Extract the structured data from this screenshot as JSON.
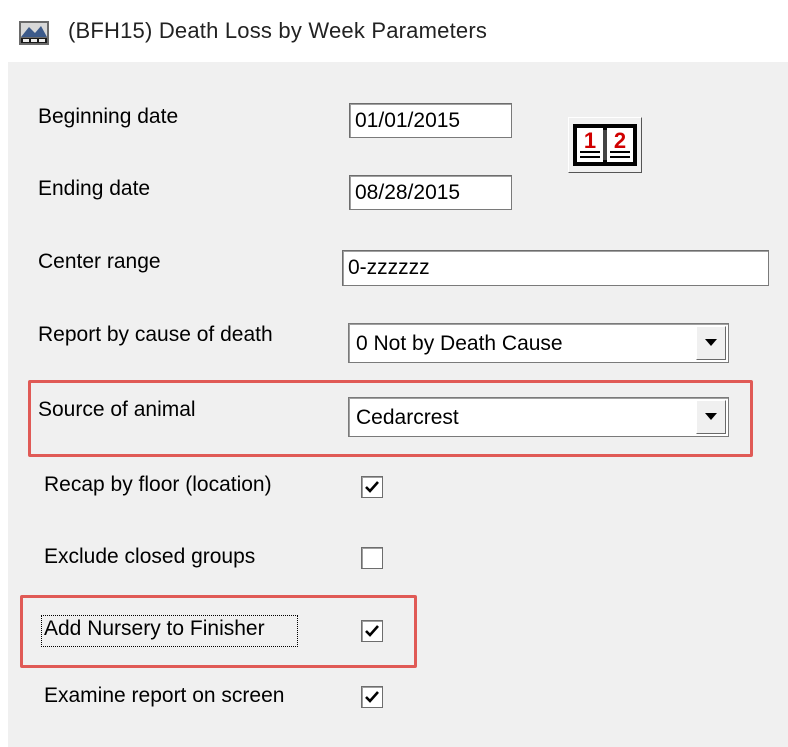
{
  "window": {
    "title": "(BFH15)  Death Loss by Week Parameters"
  },
  "fields": {
    "beginning_date": {
      "label": "Beginning date",
      "value": "01/01/2015"
    },
    "ending_date": {
      "label": "Ending date",
      "value": "08/28/2015"
    },
    "center_range": {
      "label": "Center range",
      "value": "0-zzzzzz"
    },
    "cause_of_death": {
      "label": "Report by cause of death",
      "value": "0  Not by Death Cause"
    },
    "source_of_animal": {
      "label": "Source of animal",
      "value": "Cedarcrest"
    }
  },
  "checkboxes": {
    "recap_by_floor": {
      "label": "Recap by floor (location)",
      "checked": true
    },
    "exclude_closed": {
      "label": "Exclude closed groups",
      "checked": false
    },
    "add_nursery": {
      "label": "Add Nursery to Finisher",
      "checked": true
    },
    "examine_report": {
      "label": "Examine report on screen",
      "checked": true
    }
  },
  "calendar_button": {
    "glyph_left": "1",
    "glyph_right": "2"
  },
  "colors": {
    "highlight": "#e05a56",
    "panel": "#f0f0f0"
  }
}
